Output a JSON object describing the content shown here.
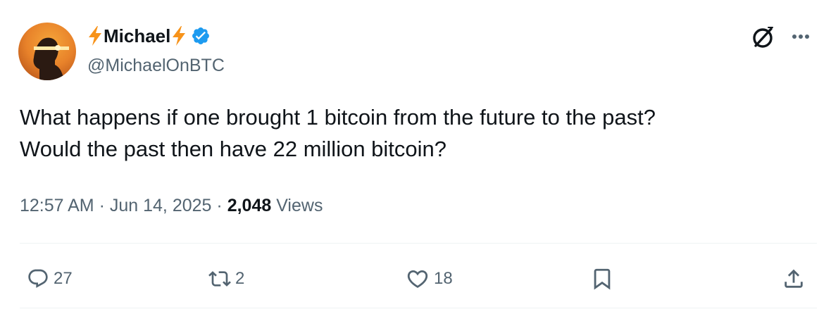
{
  "author": {
    "display_name": "Michael",
    "name_emoji": "lightning-bolt",
    "verified": true,
    "handle": "@MichaelOnBTC",
    "avatar": "person-silhouette-orange-glow"
  },
  "header_actions": {
    "grok_icon": "grok-icon",
    "more_icon": "more-options-icon"
  },
  "tweet": {
    "text_lines": [
      "What happens if one brought 1 bitcoin from the future to the past?",
      "Would the past then have 22 million bitcoin?"
    ]
  },
  "meta": {
    "time": "12:57 AM",
    "separator": "·",
    "date": "Jun 14, 2025",
    "views_count": "2,048",
    "views_label": "Views"
  },
  "actions": {
    "replies": "27",
    "reposts": "2",
    "likes": "18",
    "bookmark_icon": "bookmark-icon",
    "share_icon": "share-icon"
  },
  "colors": {
    "text_primary": "#0f1419",
    "text_secondary": "#536471",
    "verified_blue": "#1d9bf0",
    "bolt_orange": "#f7931a",
    "divider": "#eff3f4"
  }
}
